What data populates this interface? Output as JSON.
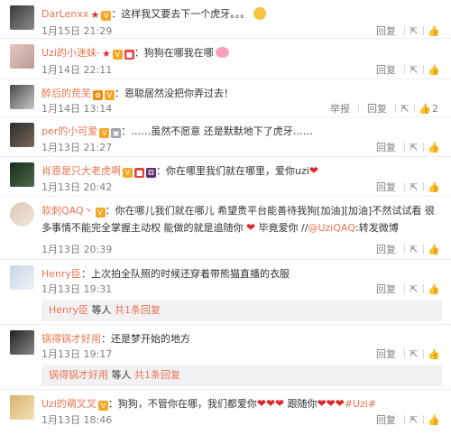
{
  "actions": {
    "report": "举报",
    "reply": "回复",
    "share_icon": "share-icon",
    "like_icon": "thumb-up-icon"
  },
  "comments": [
    {
      "user": "DarLenxx",
      "text": "：这样我又要去下一个虎牙。。。",
      "time": "1月15日 21:29",
      "likes": ""
    },
    {
      "user": "Uzi的小迷妹-",
      "text": "：狗狗在哪我在哪",
      "time": "1月14日 22:11",
      "likes": ""
    },
    {
      "user": "醉后的荒芜",
      "text": "：恩聪居然没把你弄过去！",
      "time": "1月14日 13:14",
      "likes": "2"
    },
    {
      "user": "per的小可爱",
      "text": "：……虽然不愿意 还是默默地下了虎牙……",
      "time": "1月13日 21:27",
      "likes": ""
    },
    {
      "user": "肖恩是只大老虎啊",
      "text": "：你在哪里我们就在哪里，爱你uzi",
      "time": "1月13日 20:42",
      "likes": ""
    },
    {
      "user": "软刺QAQ丶",
      "text": "：你在哪儿我们就在哪儿 希望贵平台能善待我狗[加油][加油]不然试试看 很多事情不能完全掌握主动权 能做的就是追随你",
      "text2": "毕竟爱你 //",
      "mention": "@UziQAQ",
      "text3": ":转发微博",
      "time": "1月13日 20:39",
      "likes": ""
    },
    {
      "user": "Henry臣",
      "text": "：上次拍全队照的时候还穿着带熊猫直播的衣服",
      "time": "1月13日 19:31",
      "likes": "",
      "sub_user": "Henry臣",
      "sub_mid": " 等人 ",
      "sub_more": "共1条回复"
    },
    {
      "user": "锅得锅才好用",
      "text": "：还是梦开始的地方",
      "time": "1月13日 19:17",
      "likes": "",
      "sub_user": "锅得锅才好用",
      "sub_mid": " 等人 ",
      "sub_more": "共1条回复"
    },
    {
      "user": "Uzi的萌叉叉",
      "text": "：狗狗，不管你在哪，我们都爱你",
      "text2": "跟随你",
      "tag": "#Uzi#",
      "time": "1月13日 18:46",
      "likes": ""
    }
  ]
}
